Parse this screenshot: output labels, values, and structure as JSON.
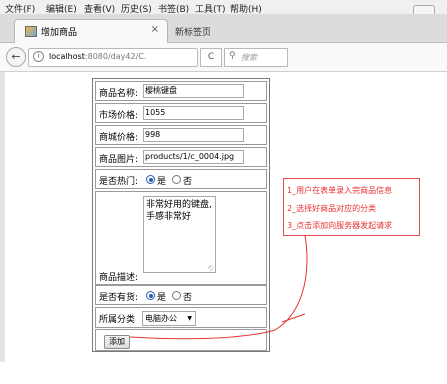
{
  "menubar": {
    "items": [
      "文件(F)",
      "编辑(E)",
      "查看(V)",
      "历史(S)",
      "书签(B)",
      "工具(T)",
      "帮助(H)"
    ]
  },
  "tabs": {
    "active_title": "增加商品",
    "close_glyph": "×",
    "new_tab_label": "新标签页"
  },
  "navbar": {
    "back_glyph": "←",
    "info_glyph": "i",
    "url_host": "localhost",
    "url_path": ":8080/day42/C.",
    "reload_glyph": "C",
    "search_placeholder": "搜索",
    "search_icon": "search-icon"
  },
  "form": {
    "name_label": "商品名称:",
    "name_value": "樱桃键盘",
    "market_price_label": "市场价格:",
    "market_price_value": "1055",
    "shop_price_label": "商城价格:",
    "shop_price_value": "998",
    "image_label": "商品图片:",
    "image_value": "products/1/c_0004.jpg",
    "hot_label": "是否热门:",
    "hot_yes": "是",
    "hot_no": "否",
    "hot_selected": "是",
    "desc_label": "商品描述:",
    "desc_value": "非常好用的键盘,手感非常好",
    "stock_label": "是否有货:",
    "stock_yes": "是",
    "stock_no": "否",
    "stock_selected": "是",
    "category_label": "所属分类",
    "category_value": "电脑办公",
    "submit_label": "添加"
  },
  "annotation": {
    "lines": [
      "1_用户在表单录入完商品信息",
      "2_选择好商品对应的分类",
      "3_点击添加向服务器发起请求"
    ],
    "color": "#e63232"
  }
}
